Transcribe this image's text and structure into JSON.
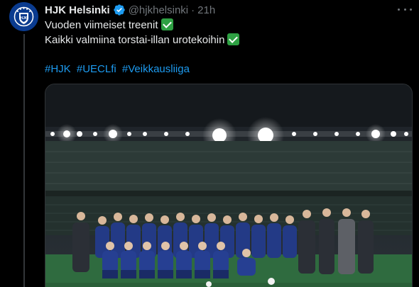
{
  "tweet": {
    "author_name": "HJK Helsinki",
    "handle": "@hjkhelsinki",
    "separator": "·",
    "time": "21h",
    "lines": [
      "Vuoden viimeiset treenit",
      "Kaikki valmiina torstai-illan urotekoihin"
    ],
    "hashtags": [
      "#HJK",
      "#UECLfi",
      "#Veikkausliiga"
    ]
  },
  "colors": {
    "background": "#000000",
    "text": "#e7e9ea",
    "muted": "#71767b",
    "link": "#1d9bf0",
    "verified": "#1d9bf0",
    "check_emoji": "#2ea043",
    "avatar": "#0a3b8f"
  },
  "media": {
    "alt": "team photo in stadium"
  },
  "icons": {
    "verified": "verified-badge-icon",
    "more": "more-icon",
    "check": "check-mark-icon"
  }
}
